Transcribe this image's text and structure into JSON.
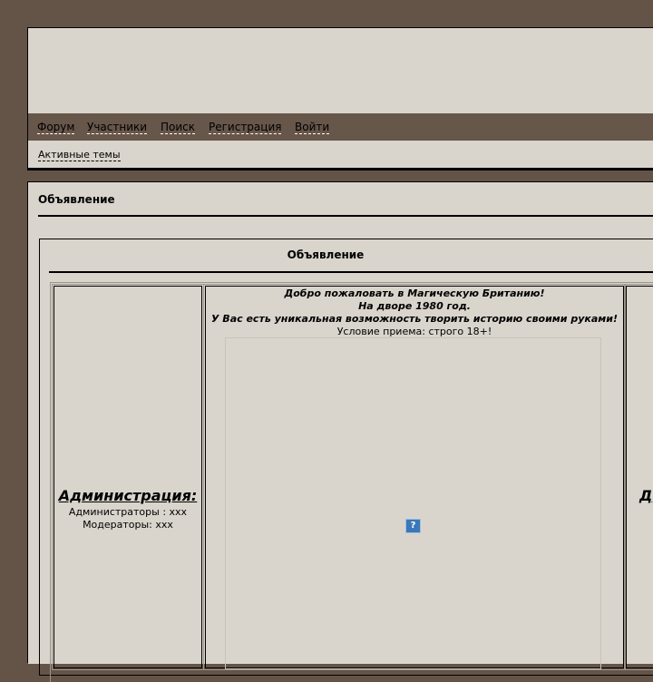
{
  "nav": {
    "items": [
      {
        "label": "Форум"
      },
      {
        "label": "Участники"
      },
      {
        "label": "Поиск"
      },
      {
        "label": "Регистрация"
      },
      {
        "label": "Войти"
      }
    ]
  },
  "subnav": {
    "active_topics": "Активные темы"
  },
  "announcement": {
    "block_title": "Объявление",
    "inner_title": "Объявление",
    "left": {
      "heading": "Администрация:",
      "admins": "Администраторы : xxx",
      "moderators": "Модераторы: xxx"
    },
    "center": {
      "welcome": "Добро пожаловать в Магическую Британию!",
      "year": "На дворе 1980 год.",
      "opportunity": "У Вас есть уникальная возможность творить историю своими руками!",
      "rules": "Условие приема: строго 18+!",
      "image_placeholder": "?"
    },
    "right": {
      "heading_fragment": "Д"
    }
  },
  "colors": {
    "background": "#645448",
    "panel": "#d9d5cc",
    "navbar": "#67564a"
  }
}
